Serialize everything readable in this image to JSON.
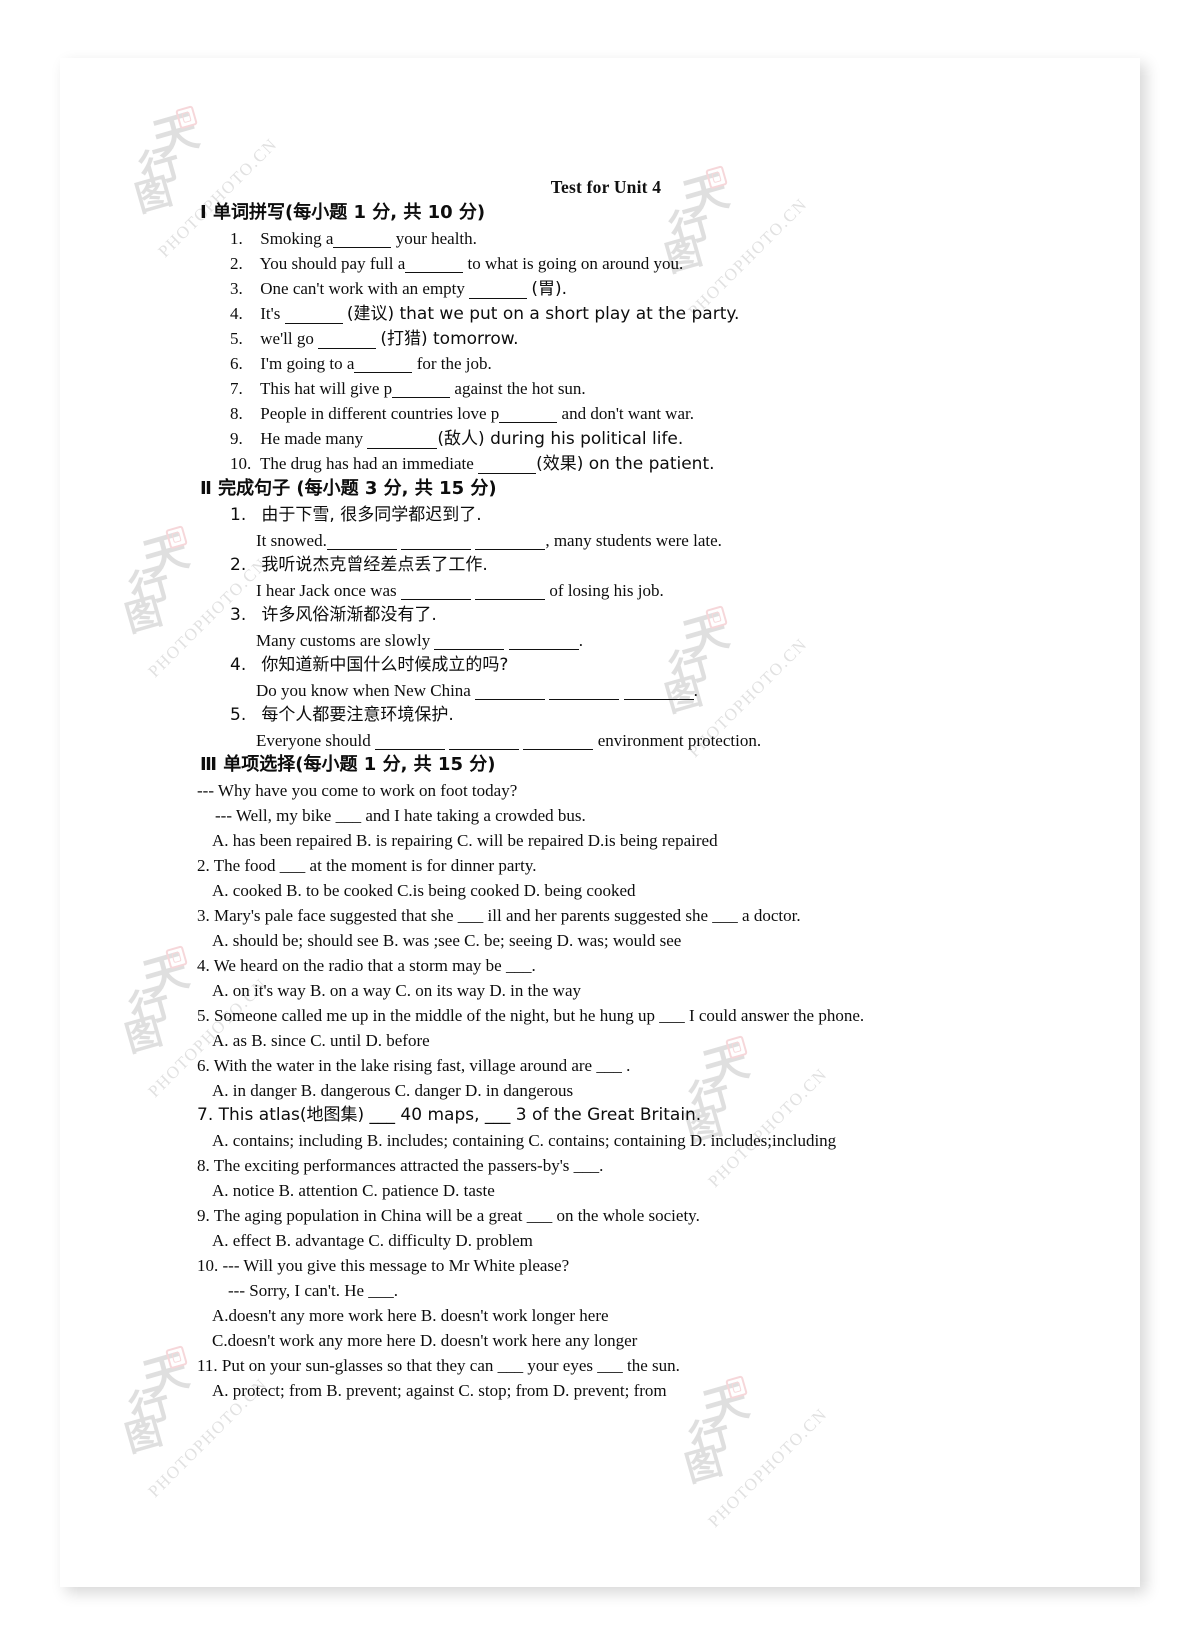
{
  "document": {
    "title": "Test for Unit 4",
    "sections": [
      {
        "id": "section-1",
        "heading": "Ⅰ 单词拼写(每小题 1 分, 共 10 分)",
        "items": [
          {
            "num": "1.",
            "pre": "Smoking a",
            "blank": "b-md",
            "post": "your health."
          },
          {
            "num": "2.",
            "pre": "You should pay full a",
            "blank": "b-md",
            "post": "to what is going on around you."
          },
          {
            "num": "3.",
            "pre": "One can't work with an empty",
            "blank": "b-md",
            "post": "(胃)."
          },
          {
            "num": "4.",
            "pre": "It's",
            "blank": "b-md",
            "post": "(建议) that we put on a short play at the party."
          },
          {
            "num": "5.",
            "pre": "we'll go",
            "blank": "b-md",
            "post": "(打猎) tomorrow."
          },
          {
            "num": "6.",
            "pre": "I'm going to a",
            "blank": "b-md",
            "post": "for the job."
          },
          {
            "num": "7.",
            "pre": "This hat will give p",
            "blank": "b-md",
            "post": "against the hot sun."
          },
          {
            "num": "8.",
            "pre": "People in different countries love p",
            "blank": "b-md",
            "post": "and don't want war."
          },
          {
            "num": "9.",
            "pre": "He made many",
            "blank": "b-lg",
            "post": "(敌人) during his political life."
          },
          {
            "num": "10.",
            "pre": "The drug has had an immediate",
            "blank": "b-md",
            "post": "(效果) on the patient."
          }
        ]
      },
      {
        "id": "section-2",
        "heading": "Ⅱ 完成句子 (每小题 3 分, 共 15 分)",
        "items": [
          {
            "num": "1.",
            "chinese": "由于下雪, 很多同学都迟到了.",
            "english_pre": "It snowed.",
            "blanks": 3,
            "english_post": ", many students were late."
          },
          {
            "num": "2.",
            "chinese": "我听说杰克曾经差点丢了工作.",
            "english_pre": "I hear Jack once was",
            "blanks": 2,
            "english_post": "of losing his job."
          },
          {
            "num": "3.",
            "chinese": "许多风俗渐渐都没有了.",
            "english_pre": "Many customs are slowly",
            "blanks": 2,
            "english_post": "."
          },
          {
            "num": "4.",
            "chinese": "你知道新中国什么时候成立的吗?",
            "english_pre": "Do you know when New China",
            "blanks": 3,
            "english_post": "."
          },
          {
            "num": "5.",
            "chinese": "每个人都要注意环境保护.",
            "english_pre": "Everyone should",
            "blanks": 3,
            "english_post": "environment protection."
          }
        ]
      },
      {
        "id": "section-3",
        "heading": "Ⅲ 单项选择(每小题 1 分, 共 15 分)",
        "questions": [
          {
            "num": "1.",
            "stem_lines": [
              "--- Why have you come to work on foot today?",
              "--- Well, my bike ___ and I hate taking a crowded bus."
            ],
            "option_lines": [
              "A. has been repaired   B. is repairing   C. will be repaired   D.is being repaired"
            ]
          },
          {
            "num": "2.",
            "stem_lines": [
              "The food ___ at the moment is for dinner party."
            ],
            "option_lines": [
              "A. cooked   B. to be cooked   C.is being cooked   D. being cooked"
            ]
          },
          {
            "num": "3.",
            "stem_lines": [
              "Mary's pale face suggested that she ___ ill and her parents suggested she ___ a doctor."
            ],
            "option_lines": [
              "A. should be; should see      B. was ;see      C. be; seeing      D. was; would see"
            ]
          },
          {
            "num": "4.",
            "stem_lines": [
              "We heard on the radio that a storm may be ___."
            ],
            "option_lines": [
              "A. on it's way    B. on a way    C. on its way        D. in the way"
            ]
          },
          {
            "num": "5.",
            "stem_lines": [
              "Someone called me up in the middle of the night, but he hung up ___ I could answer the phone."
            ],
            "option_lines": [
              "A. as    B. since    C. until      D. before"
            ]
          },
          {
            "num": "6.",
            "stem_lines": [
              "With the water in the lake rising fast, village around are ___ ."
            ],
            "option_lines": [
              "A. in danger   B. dangerous   C. danger   D. in dangerous"
            ]
          },
          {
            "num": "7.",
            "stem_lines": [
              "This atlas(地图集) ___ 40 maps, ___ 3 of the Great Britain."
            ],
            "option_lines": [
              "A. contains; including   B. includes; containing C. contains; containing D. includes;including"
            ]
          },
          {
            "num": "8.",
            "stem_lines": [
              "The exciting performances attracted the passers-by's ___."
            ],
            "option_lines": [
              "A. notice   B. attention   C. patience   D. taste"
            ]
          },
          {
            "num": "9.",
            "stem_lines": [
              "The aging population in China will be a great ___ on the whole society."
            ],
            "option_lines": [
              "A. effect   B. advantage   C. difficulty   D. problem"
            ]
          },
          {
            "num": "10.",
            "stem_lines": [
              "--- Will you give this message to Mr White please?",
              "--- Sorry, I can't. He ___."
            ],
            "option_lines": [
              "A.doesn't any more work here   B. doesn't work longer here",
              "C.doesn't work any more here    D. doesn't work here any longer"
            ]
          },
          {
            "num": "11.",
            "stem_lines": [
              "Put on your sun-glasses so that they can ___ your eyes ___ the sun."
            ],
            "option_lines": [
              "A. protect; from     B. prevent; against     C. stop; from     D. prevent; from"
            ]
          }
        ]
      }
    ]
  },
  "watermark": {
    "text": "PHOTOPHOTO.CN",
    "logo_chars": [
      "天",
      "行",
      "图"
    ],
    "color": "#c9c9c9",
    "seal_color": "#f0b8bc"
  }
}
